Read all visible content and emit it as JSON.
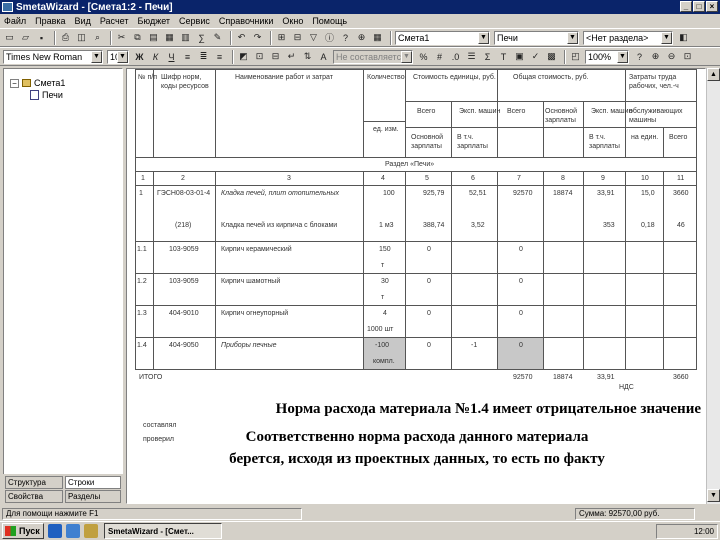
{
  "window": {
    "title": "SmetaWizard - [Смета1:2 - Печи]"
  },
  "menu": [
    "Файл",
    "Правка",
    "Вид",
    "Расчет",
    "Бюджет",
    "Сервис",
    "Справочники",
    "Окно",
    "Помощь"
  ],
  "toolbar2": {
    "font": "Times New Roman",
    "size": "10",
    "style_combo": "Не составляется_ме",
    "zoom": "100%"
  },
  "toolbar1": {
    "estimate_combo": "Смета1",
    "section_combo": "Печи",
    "chapter_combo": "<Нет раздела>"
  },
  "tree": {
    "root": "Смета1",
    "child": "Печи"
  },
  "left_tabs": [
    "Структура",
    "Строки",
    "Свойства",
    "Разделы"
  ],
  "grid": {
    "header_top": [
      "№ п/п",
      "Шифр норм, коды ресурсов",
      "Наименование работ и затрат",
      "Количество",
      "Стоимость единицы, руб.",
      "Общая стоимость, руб.",
      "Затраты труда рабочих, чел.-ч"
    ],
    "header_sub1": [
      "Всего",
      "Эксп. машин",
      "Всего",
      "Основной зарплаты",
      "Эксп. машин",
      "обслуживающих машины"
    ],
    "header_sub2": [
      "ед. изм.",
      "Основной зарплаты",
      "В т.ч. зарплаты",
      "В т.ч. зарплаты",
      "на един.",
      "Всего"
    ],
    "section": "Раздел «Печи»",
    "colnums": [
      "1",
      "2",
      "3",
      "4",
      "5",
      "6",
      "7",
      "8",
      "9",
      "10",
      "11"
    ],
    "rows": [
      {
        "n": "1",
        "code": "ГЭСН08-03-01-4",
        "name": "Кладка печей, плит отопительных",
        "qty": "100",
        "c5": "925,79",
        "c6": "52,51",
        "c7": "92570",
        "c8": "18874",
        "c9": "33,91",
        "c10": "15,0",
        "c11": "3660"
      },
      {
        "n": "",
        "code": "(218)",
        "name": "Кладка печей из кирпича с блоками",
        "qty": "1 м3",
        "c5": "388,74",
        "c6": "3,52",
        "c7": "",
        "c8": "",
        "c9": "353",
        "c10": "0,18",
        "c11": "46"
      },
      {
        "n": "1.1",
        "code": "103-9059",
        "name": "Кирпич керамический",
        "qty": "150",
        "c5": "0",
        "c7": "0"
      },
      {
        "n": "1.2",
        "code": "103-9059",
        "name": "Кирпич шамотный",
        "qty": "30",
        "c5": "0",
        "c7": "0"
      },
      {
        "n": "1.3",
        "code": "404-9010",
        "name": "Кирпич огнеупорный",
        "qty": "4",
        "c5": "0",
        "c7": "0"
      },
      {
        "n": "1.4",
        "code": "404-9050",
        "name": "Приборы печные",
        "qty": "-100",
        "c5": "0",
        "c6": "-1",
        "c7": "0"
      }
    ],
    "qty_units": [
      "т",
      "т",
      "1000 шт",
      "компл."
    ],
    "total": {
      "label": "ИТОГО",
      "c7": "92570",
      "c8": "18874",
      "c9": "33,91",
      "c11": "3660"
    },
    "bottom": [
      "составлял",
      "проверил"
    ],
    "nds": "НДС"
  },
  "overlay": {
    "line1": "Норма расхода материала №1.4 имеет отрицательное значение",
    "line2": "Соответственно норма расхода данного материала",
    "line3": "берется, исходя из проектных данных, то есть по факту"
  },
  "status": {
    "hint": "Для помощи нажмите F1",
    "sum": "Сумма: 92570,00 руб."
  },
  "taskbar": {
    "start": "Пуск",
    "task": "SmetaWizard - [Смет...",
    "time": "12:00"
  }
}
